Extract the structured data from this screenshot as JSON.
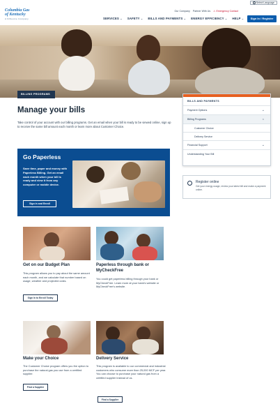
{
  "topbar": {
    "language_label": "Select Language"
  },
  "logo": {
    "line1": "Columbia Gas",
    "line2": "of Kentucky",
    "line3": "A NiSource Company"
  },
  "utility_links": [
    "Our Company",
    "Partner With Us",
    "Emergency Contact"
  ],
  "nav": {
    "items": [
      "SERVICES",
      "SAFETY",
      "BILLS AND PAYMENTS",
      "ENERGY EFFICIENCY",
      "HELP"
    ],
    "signin_label": "Sign In / Register"
  },
  "badge": "BILLING PROGRAMS",
  "page_title": "Manage your bills",
  "intro": "Take control of your account with our billing programs. Get an email when your bill is ready to be viewed online, sign up to receive the same bill amount each month or learn more about Customer Choice.",
  "sidenav": {
    "title": "BILLS AND PAYMENTS",
    "items": [
      {
        "label": "Payment Options",
        "chevron": "v"
      },
      {
        "label": "Billing Programs",
        "chevron": "^"
      },
      {
        "label": "Customer Choice"
      },
      {
        "label": "Delivery Service"
      },
      {
        "label": "Financial Support",
        "chevron": "v"
      },
      {
        "label": "Understanding Your Bill"
      }
    ]
  },
  "register": {
    "title": "Register online",
    "text": "Get your energy usage, review your latest bill and make a payment online."
  },
  "paperless": {
    "title": "Go Paperless",
    "text": "Save time, paper and money with Paperless Billing. Get an email each month when your bill is ready and view it from any computer or mobile device.",
    "button": "Sign in and Enroll"
  },
  "cards": [
    {
      "title": "Get on our Budget Plan",
      "text": "This program allows you to pay about the same amount each month, and we calculate that number based on usage, weather and projected costs.",
      "button": "Sign In to Enroll Today"
    },
    {
      "title": "Paperless through bank or MyCheckFree",
      "text": "You could get paperless billing through your bank or MyCheckFree. Learn more at your bank's website or MyCheckFree's website.",
      "button": ""
    },
    {
      "title": "Make your Choice",
      "text": "The Customer Choice program offers you the option to purchase the natural gas you use from a certified supplier.",
      "button": "Find a Supplier"
    },
    {
      "title": "Delivery Service",
      "text": "This program is available to our commercial and industrial customers who consume more than 25,000 MCF per year. You can choose to purchase your natural gas from a certified supplier instead of us.",
      "button": "Find a Supplier"
    }
  ]
}
